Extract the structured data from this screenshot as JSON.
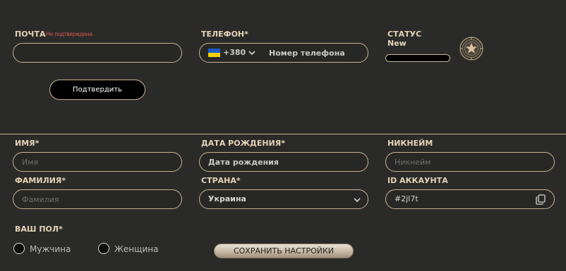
{
  "email": {
    "label": "ПОЧТА",
    "warning": "Не подтверждена",
    "value": "",
    "confirm_label": "Подтвердить"
  },
  "phone": {
    "label": "ТЕЛЕФОН*",
    "flag": "ukraine-flag-icon",
    "code": "+380",
    "placeholder": "Номер телефона"
  },
  "status": {
    "label": "СТАТУС",
    "value": "New",
    "progress": 0,
    "badge_icon": "star-badge-icon"
  },
  "form": {
    "first_name": {
      "label": "ИМЯ*",
      "placeholder": "Имя"
    },
    "birth_date": {
      "label": "ДАТА РОЖДЕНИЯ*",
      "placeholder": "Дата рождения"
    },
    "nickname": {
      "label": "НИКНЕЙМ",
      "placeholder": "Никнейм"
    },
    "last_name": {
      "label": "ФАМИЛИЯ*",
      "placeholder": "Фамилия"
    },
    "country": {
      "label": "СТРАНА*",
      "value": "Украина"
    },
    "account_id": {
      "label": "ID АККАУНТА",
      "value": "#2jl7t",
      "copy_icon": "copy-icon"
    }
  },
  "gender": {
    "label": "ВАШ ПОЛ*",
    "options": [
      "Мужчина",
      "Женщина"
    ]
  },
  "save_label": "СОХРАНИТЬ НАСТРОЙКИ",
  "colors": {
    "background": "#2a2b29",
    "accent": "#c9b391",
    "label": "#e6d3b6",
    "warning": "#e05656"
  }
}
